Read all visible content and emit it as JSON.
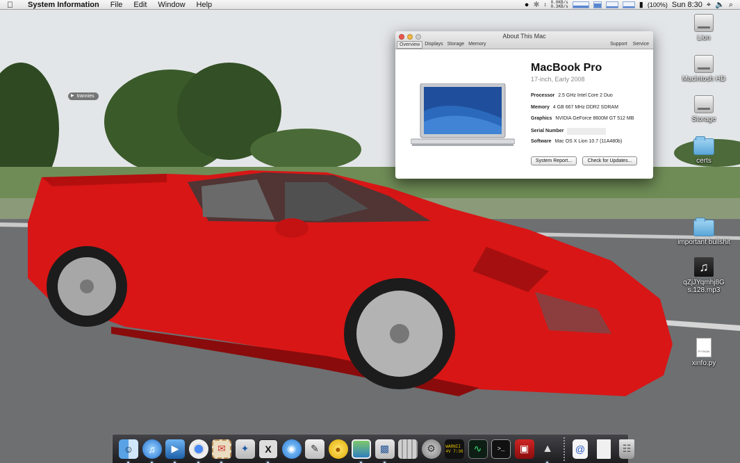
{
  "menubar": {
    "apple_icon": "apple-icon",
    "app_name": "System Information",
    "items": [
      "File",
      "Edit",
      "Window",
      "Help"
    ],
    "net_down": "0.0KB/s",
    "net_up": "0.3KB/s",
    "battery": "(100%)",
    "clock": "Sun 8:30"
  },
  "desktop": {
    "stack_label": "trannies",
    "icons": [
      {
        "label": "Lion",
        "type": "drive"
      },
      {
        "label": "Macintosh HD",
        "type": "drive"
      },
      {
        "label": "Storage",
        "type": "drive"
      },
      {
        "label": "certs",
        "type": "folder"
      },
      {
        "label": "important bullshit",
        "type": "folder"
      },
      {
        "label": "qZjJYqmhj8Gs.128.mp3",
        "type": "audio"
      },
      {
        "label": "xinfo.py",
        "type": "python"
      }
    ],
    "py_badge": "PYTHON"
  },
  "window": {
    "title": "About This Mac",
    "tabs": [
      "Overview",
      "Displays",
      "Storage",
      "Memory"
    ],
    "selected_tab": "Overview",
    "right_links": [
      "Support",
      "Service"
    ],
    "model": "MacBook Pro",
    "submodel": "17-inch, Early 2008",
    "specs": {
      "processor_label": "Processor",
      "processor": "2.5 GHz Intel Core 2 Duo",
      "memory_label": "Memory",
      "memory": "4 GB 667 MHz DDR2 SDRAM",
      "graphics_label": "Graphics",
      "graphics": "NVIDIA GeForce 8600M GT 512 MB",
      "serial_label": "Serial Number",
      "software_label": "Software",
      "software": "Mac OS X Lion 10.7 (11A480b)"
    },
    "buttons": {
      "system_report": "System Report...",
      "check_updates": "Check for Updates..."
    }
  },
  "dock": {
    "items": [
      {
        "name": "finder",
        "icon": "finder-icon",
        "running": true
      },
      {
        "name": "itunes",
        "icon": "itunes-icon",
        "running": true
      },
      {
        "name": "quicktime",
        "icon": "quicktime-icon",
        "running": true
      },
      {
        "name": "chrome",
        "icon": "chrome-icon",
        "running": true
      },
      {
        "name": "mail",
        "icon": "mail-stamp-icon",
        "running": true
      },
      {
        "name": "sparrow",
        "icon": "sparrow-icon",
        "running": false
      },
      {
        "name": "x11",
        "icon": "x11-icon",
        "running": true
      },
      {
        "name": "facetime",
        "icon": "video-camera-icon",
        "running": false
      },
      {
        "name": "script-editor",
        "icon": "script-editor-icon",
        "running": false
      },
      {
        "name": "adium",
        "icon": "duck-icon",
        "running": false
      },
      {
        "name": "preview",
        "icon": "photos-icon",
        "running": true
      },
      {
        "name": "system-info",
        "icon": "computer-icon",
        "running": true
      },
      {
        "name": "calculator",
        "icon": "calculator-icon",
        "running": false
      },
      {
        "name": "system-preferences",
        "icon": "gear-icon",
        "running": false
      },
      {
        "name": "console",
        "icon": "console-icon",
        "running": false
      },
      {
        "name": "activity-monitor",
        "icon": "activity-monitor-icon",
        "running": false
      },
      {
        "name": "terminal",
        "icon": "terminal-icon",
        "running": false
      },
      {
        "name": "photo-booth",
        "icon": "photo-booth-icon",
        "running": false
      },
      {
        "name": "alfred",
        "icon": "hat-icon",
        "running": true
      },
      {
        "name": "url-document",
        "icon": "at-document-icon",
        "running": false
      },
      {
        "name": "documents",
        "icon": "document-icon",
        "running": false
      },
      {
        "name": "trash",
        "icon": "trash-icon",
        "running": false
      }
    ],
    "console_text": "WARNII\n4V 7:36"
  }
}
